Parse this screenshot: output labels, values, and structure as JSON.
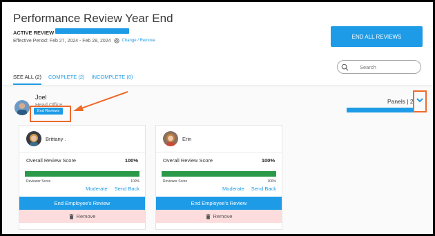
{
  "header": {
    "title": "Performance Review Year End",
    "active_label": "ACTIVE REVIEW",
    "period_text": "Effective Period: Feb 27, 2024 - Feb 28, 2024",
    "change_label": "Change",
    "separator": "/",
    "remove_label": "Remove",
    "end_all_label": "END ALL REVIEWS"
  },
  "search": {
    "placeholder": "Search"
  },
  "tabs": [
    {
      "label": "SEE ALL (2)",
      "active": true
    },
    {
      "label": "COMPLETE (2)",
      "active": false
    },
    {
      "label": "INCOMPLETE (0)",
      "active": false
    }
  ],
  "employee": {
    "name": "Joel",
    "department": "Head Office",
    "end_reviews_label": "End Reviews",
    "panels_label": "Panels | 2"
  },
  "cards": [
    {
      "reviewer_name": "Brittany .",
      "overall_label": "Overall Review Score",
      "overall_value": "100%",
      "overall_progress": 1.0,
      "reviewer_score_label": "Reviewer Score",
      "reviewer_score_value": "100%",
      "moderate_label": "Moderate",
      "send_back_label": "Send Back",
      "end_review_label": "End Employee's Review",
      "remove_label": "Remove"
    },
    {
      "reviewer_name": "Erin",
      "overall_label": "Overall Review Score",
      "overall_value": "100%",
      "overall_progress": 1.0,
      "reviewer_score_label": "Reviewer Score",
      "reviewer_score_value": "100%",
      "moderate_label": "Moderate",
      "send_back_label": "Send Back",
      "end_review_label": "End Employee's Review",
      "remove_label": "Remove"
    }
  ],
  "colors": {
    "accent": "#1e9be6",
    "progress": "#2a9a48",
    "highlight": "#ee6a2a",
    "remove_bg": "#fcdcdc"
  }
}
